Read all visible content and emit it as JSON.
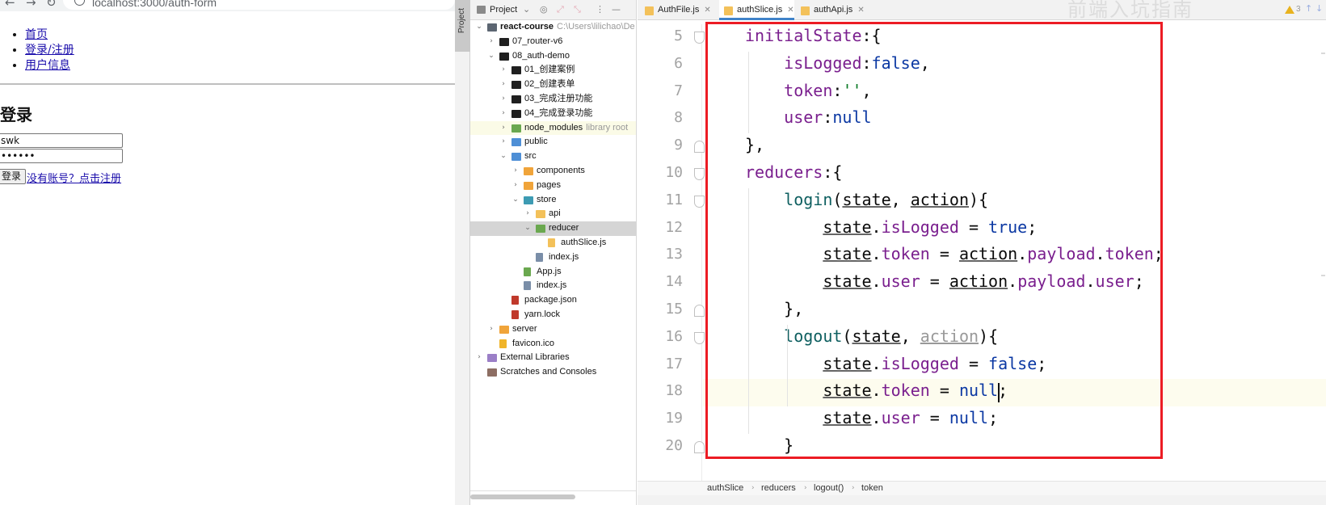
{
  "browser": {
    "url": "localhost:3000/auth-form",
    "nav_links": [
      "首页",
      "登录/注册",
      "用户信息"
    ],
    "login_title": "登录",
    "username_value": "swk",
    "password_value": "••••••",
    "login_button": "登录",
    "register_link": "没有账号？点击注册"
  },
  "ide": {
    "strip_label": "Project",
    "project_panel": {
      "title": "Project",
      "tree": [
        {
          "name": "react-course",
          "hint": "C:\\Users\\lilichao\\De",
          "depth": 0,
          "arrow": "down",
          "icon": "folder-module",
          "bold": true
        },
        {
          "name": "07_router-v6",
          "depth": 1,
          "arrow": "right",
          "icon": "folder-dark"
        },
        {
          "name": "08_auth-demo",
          "depth": 1,
          "arrow": "down",
          "icon": "folder-dark"
        },
        {
          "name": "01_创建案例",
          "depth": 2,
          "arrow": "right",
          "icon": "folder-dark"
        },
        {
          "name": "02_创建表单",
          "depth": 2,
          "arrow": "right",
          "icon": "folder-dark"
        },
        {
          "name": "03_完成注册功能",
          "depth": 2,
          "arrow": "right",
          "icon": "folder-dark"
        },
        {
          "name": "04_完成登录功能",
          "depth": 2,
          "arrow": "right",
          "icon": "folder-dark"
        },
        {
          "name": "node_modules",
          "hint": "library root",
          "depth": 2,
          "arrow": "right",
          "icon": "folder-green",
          "muted": true
        },
        {
          "name": "public",
          "depth": 2,
          "arrow": "right",
          "icon": "folder-blue"
        },
        {
          "name": "src",
          "depth": 2,
          "arrow": "down",
          "icon": "folder-blue"
        },
        {
          "name": "components",
          "depth": 3,
          "arrow": "right",
          "icon": "folder-orange"
        },
        {
          "name": "pages",
          "depth": 3,
          "arrow": "right",
          "icon": "folder-orange"
        },
        {
          "name": "store",
          "depth": 3,
          "arrow": "down",
          "icon": "folder-teal"
        },
        {
          "name": "api",
          "depth": 4,
          "arrow": "right",
          "icon": "folder-yellow"
        },
        {
          "name": "reducer",
          "depth": 4,
          "arrow": "down",
          "icon": "folder-green",
          "selected": true
        },
        {
          "name": "authSlice.js",
          "depth": 5,
          "arrow": "",
          "icon": "file-js"
        },
        {
          "name": "index.js",
          "depth": 4,
          "arrow": "",
          "icon": "file-lines"
        },
        {
          "name": "App.js",
          "depth": 3,
          "arrow": "",
          "icon": "file-react"
        },
        {
          "name": "index.js",
          "depth": 3,
          "arrow": "",
          "icon": "file-lines"
        },
        {
          "name": "package.json",
          "depth": 2,
          "arrow": "",
          "icon": "file-npm"
        },
        {
          "name": "yarn.lock",
          "depth": 2,
          "arrow": "",
          "icon": "file-lock"
        },
        {
          "name": "server",
          "depth": 1,
          "arrow": "right",
          "icon": "folder-orange"
        },
        {
          "name": "favicon.ico",
          "depth": 1,
          "arrow": "",
          "icon": "file-star"
        },
        {
          "name": "External Libraries",
          "depth": 0,
          "arrow": "right",
          "icon": "library"
        },
        {
          "name": "Scratches and Consoles",
          "depth": 0,
          "arrow": "",
          "icon": "scratches"
        }
      ]
    },
    "tabs": [
      {
        "label": "AuthFile.js",
        "active": false
      },
      {
        "label": "authSlice.js",
        "active": true
      },
      {
        "label": "authApi.js",
        "active": false
      }
    ],
    "watermark": "前端入坑指南",
    "warning_count": "3",
    "code_lines": [
      {
        "n": "5",
        "fold": "open",
        "parts": [
          [
            "p",
            "initialState"
          ],
          [
            "",
            ":{"
          ]
        ]
      },
      {
        "n": "6",
        "fold": "",
        "parts": [
          [
            "",
            "    "
          ],
          [
            "p",
            "isLogged"
          ],
          [
            "",
            ":"
          ],
          [
            "k",
            "false"
          ],
          [
            "",
            ","
          ]
        ]
      },
      {
        "n": "7",
        "fold": "",
        "parts": [
          [
            "",
            "    "
          ],
          [
            "p",
            "token"
          ],
          [
            "",
            ":"
          ],
          [
            "s",
            "''"
          ],
          [
            "",
            ","
          ]
        ]
      },
      {
        "n": "8",
        "fold": "",
        "parts": [
          [
            "",
            "    "
          ],
          [
            "p",
            "user"
          ],
          [
            "",
            ":"
          ],
          [
            "k",
            "null"
          ]
        ]
      },
      {
        "n": "9",
        "fold": "close",
        "parts": [
          [
            "",
            "},"
          ]
        ]
      },
      {
        "n": "10",
        "fold": "open",
        "parts": [
          [
            "p",
            "reducers"
          ],
          [
            "",
            ":{"
          ]
        ]
      },
      {
        "n": "11",
        "fold": "open",
        "parts": [
          [
            "",
            "    "
          ],
          [
            "f",
            "login"
          ],
          [
            "",
            "("
          ],
          [
            "u",
            "state"
          ],
          [
            "",
            ", "
          ],
          [
            "u",
            "action"
          ],
          [
            "",
            "){"
          ]
        ]
      },
      {
        "n": "12",
        "fold": "",
        "parts": [
          [
            "",
            "        "
          ],
          [
            "u",
            "state"
          ],
          [
            "",
            "."
          ],
          [
            "p",
            "isLogged"
          ],
          [
            "",
            " = "
          ],
          [
            "k",
            "true"
          ],
          [
            "",
            ";"
          ]
        ]
      },
      {
        "n": "13",
        "fold": "",
        "parts": [
          [
            "",
            "        "
          ],
          [
            "u",
            "state"
          ],
          [
            "",
            "."
          ],
          [
            "p",
            "token"
          ],
          [
            "",
            " = "
          ],
          [
            "u",
            "action"
          ],
          [
            "",
            "."
          ],
          [
            "p",
            "payload"
          ],
          [
            "",
            "."
          ],
          [
            "p",
            "token"
          ],
          [
            "",
            ";"
          ]
        ]
      },
      {
        "n": "14",
        "fold": "",
        "parts": [
          [
            "",
            "        "
          ],
          [
            "u",
            "state"
          ],
          [
            "",
            "."
          ],
          [
            "p",
            "user"
          ],
          [
            "",
            " = "
          ],
          [
            "u",
            "action"
          ],
          [
            "",
            "."
          ],
          [
            "p",
            "payload"
          ],
          [
            "",
            "."
          ],
          [
            "p",
            "user"
          ],
          [
            "",
            ";"
          ]
        ]
      },
      {
        "n": "15",
        "fold": "close",
        "parts": [
          [
            "",
            "    },"
          ]
        ]
      },
      {
        "n": "16",
        "fold": "open",
        "parts": [
          [
            "",
            "    "
          ],
          [
            "f",
            "logout"
          ],
          [
            "",
            "("
          ],
          [
            "u",
            "state"
          ],
          [
            "",
            ", "
          ],
          [
            "ug",
            "action"
          ],
          [
            "",
            "){"
          ]
        ]
      },
      {
        "n": "17",
        "fold": "",
        "parts": [
          [
            "",
            "        "
          ],
          [
            "u",
            "state"
          ],
          [
            "",
            "."
          ],
          [
            "p",
            "isLogged"
          ],
          [
            "",
            " = "
          ],
          [
            "k",
            "false"
          ],
          [
            "",
            ";"
          ]
        ]
      },
      {
        "n": "18",
        "fold": "",
        "caret": true,
        "parts": [
          [
            "",
            "        "
          ],
          [
            "u",
            "state"
          ],
          [
            "",
            "."
          ],
          [
            "p",
            "token"
          ],
          [
            "",
            " = "
          ],
          [
            "k",
            "null"
          ],
          [
            "",
            ";"
          ]
        ]
      },
      {
        "n": "19",
        "fold": "",
        "parts": [
          [
            "",
            "        "
          ],
          [
            "u",
            "state"
          ],
          [
            "",
            "."
          ],
          [
            "p",
            "user"
          ],
          [
            "",
            " = "
          ],
          [
            "k",
            "null"
          ],
          [
            "",
            ";"
          ]
        ]
      },
      {
        "n": "20",
        "fold": "close",
        "parts": [
          [
            "",
            "    }"
          ]
        ]
      }
    ],
    "breadcrumb": [
      "authSlice",
      "reducers",
      "logout()",
      "token"
    ]
  },
  "colors": {
    "highlight_border": "#ec1c24",
    "keyword": "#0b38a3",
    "property": "#7a1f8e",
    "function": "#0e5f60",
    "string": "#0a7a25",
    "active_tab_underline": "#4083c9"
  }
}
